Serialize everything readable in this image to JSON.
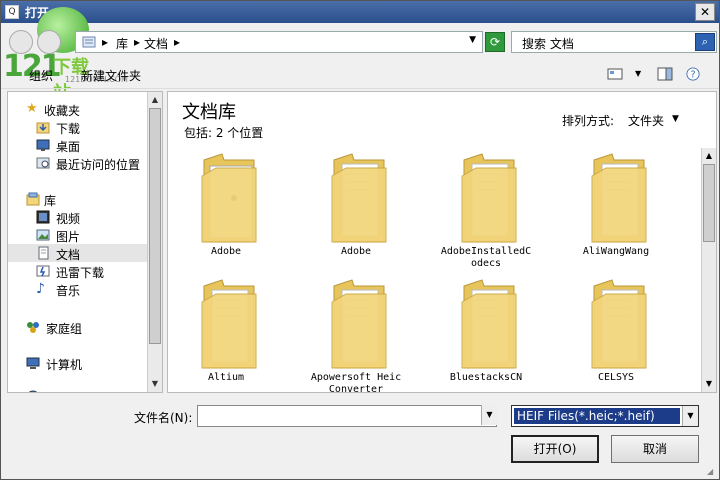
{
  "window": {
    "title": "打开",
    "close_glyph": "✕"
  },
  "logo": {
    "number": "121",
    "text": "下载站",
    "sub": "121DOWN.COM"
  },
  "address": {
    "crumbs": [
      "库",
      "文档"
    ],
    "separator": "▸"
  },
  "search": {
    "placeholder": "搜索 文档"
  },
  "toolbar": {
    "organize": "组织",
    "new_folder": "新建文件夹"
  },
  "sidebar": {
    "favorites": {
      "label": "收藏夹",
      "items": [
        "下载",
        "桌面",
        "最近访问的位置"
      ]
    },
    "libraries": {
      "label": "库",
      "items": [
        "视频",
        "图片",
        "文档",
        "迅雷下载",
        "音乐"
      ]
    },
    "homegroup": "家庭组",
    "computer": "计算机",
    "network": "网络"
  },
  "content": {
    "title": "文档库",
    "subtitle": "包括: 2 个位置",
    "arrange_label": "排列方式:",
    "arrange_value": "文件夹",
    "folders": [
      "Adobe",
      "Adobe",
      "AdobeInstalledC odecs",
      "AliWangWang",
      "Altium",
      "Apowersoft Heic Converter",
      "BluestacksCN",
      "CELSYS"
    ]
  },
  "bottom": {
    "filename_label": "文件名(N):",
    "filename_value": "",
    "filetype_value": "HEIF Files(*.heic;*.heif)",
    "open_button": "打开(O)",
    "cancel_button": "取消"
  },
  "colors": {
    "titlebar": "#2b4f8c",
    "selection": "#1c3c8a",
    "folder": "#f3d57a"
  }
}
